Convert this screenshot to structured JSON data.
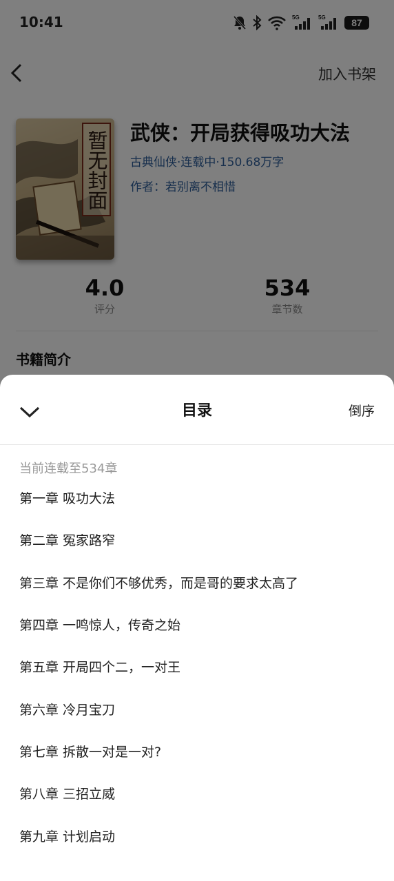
{
  "status_bar": {
    "time": "10:41",
    "battery": "87",
    "sim1_tag": "5G",
    "sim2_tag": "5G",
    "icons": [
      "bell-muted-icon",
      "bluetooth-icon",
      "wifi-icon",
      "signal-icon",
      "signal-icon",
      "battery-icon"
    ]
  },
  "nav": {
    "back_icon": "chevron-left-icon",
    "add_to_shelf": "加入书架"
  },
  "book": {
    "cover_text": "暂无封面",
    "title": "武侠：开局获得吸功大法",
    "meta": "古典仙侠·连载中·150.68万字",
    "author": "作者：若别离不相惜"
  },
  "stats": {
    "rating_value": "4.0",
    "rating_label": "评分",
    "chapters_value": "534",
    "chapters_label": "章节数"
  },
  "intro": {
    "title": "书籍简介"
  },
  "catalog": {
    "collapse_icon": "chevron-down-icon",
    "title": "目录",
    "sort_label": "倒序",
    "progress_note": "当前连载至534章",
    "chapters": [
      {
        "num": "第一章",
        "name": "吸功大法"
      },
      {
        "num": "第二章",
        "name": "冤家路窄"
      },
      {
        "num": "第三章",
        "name": "不是你们不够优秀，而是哥的要求太高了"
      },
      {
        "num": "第四章",
        "name": "一鸣惊人，传奇之始"
      },
      {
        "num": "第五章",
        "name": "开局四个二，一对王"
      },
      {
        "num": "第六章",
        "name": "冷月宝刀"
      },
      {
        "num": "第七章",
        "name": "拆散一对是一对?"
      },
      {
        "num": "第八章",
        "name": "三招立威"
      },
      {
        "num": "第九章",
        "name": "计划启动"
      }
    ]
  },
  "colors": {
    "overlay": "#000000",
    "link_blue": "#2f5f9a",
    "muted_text": "#9a9a9a"
  }
}
